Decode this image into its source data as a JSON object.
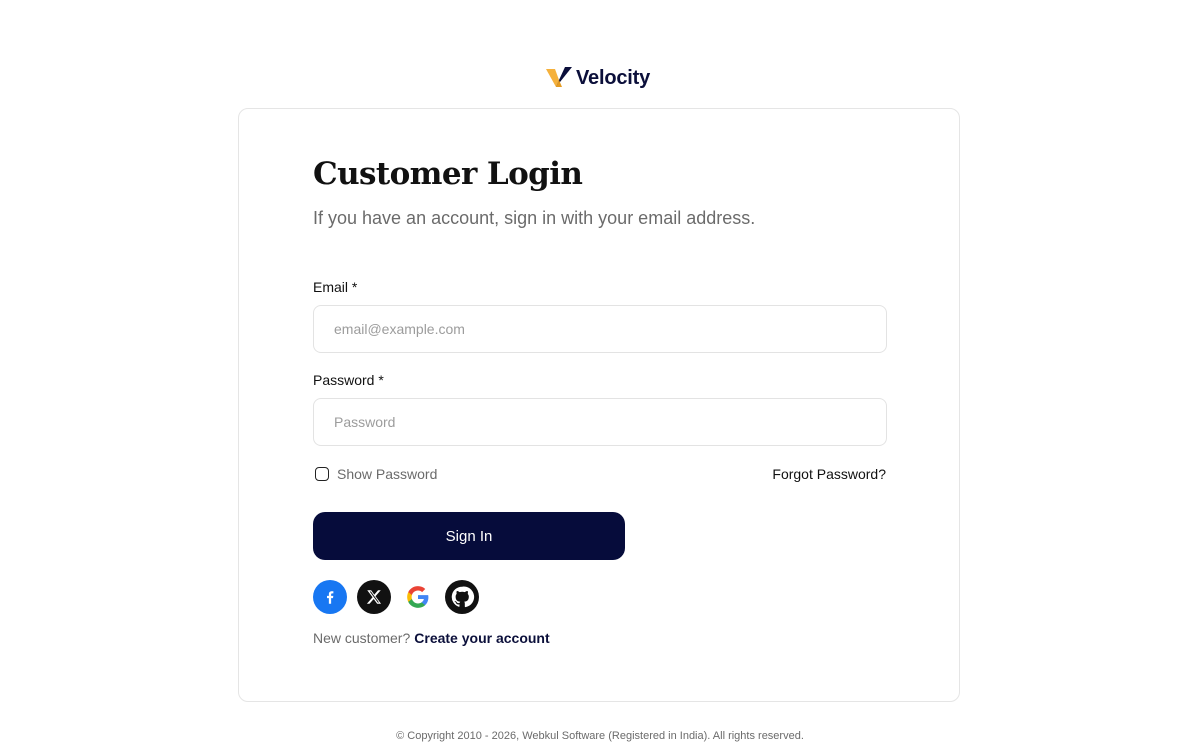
{
  "brand": {
    "name": "Velocity",
    "logo_icon": "velocity-v-logo",
    "colors": {
      "mark_gold": "#f5b13c",
      "mark_navy": "#0b0f3a"
    }
  },
  "login": {
    "title": "Customer Login",
    "subtitle": "If you have an account, sign in with your email address.",
    "email": {
      "label": "Email *",
      "placeholder": "email@example.com",
      "value": ""
    },
    "password": {
      "label": "Password *",
      "placeholder": "Password",
      "value": ""
    },
    "show_password": {
      "label": "Show Password",
      "checked": false
    },
    "forgot_password": "Forgot Password?",
    "submit": "Sign In",
    "socials": [
      {
        "name": "facebook",
        "icon": "facebook-icon",
        "color": "#1877f2"
      },
      {
        "name": "x",
        "icon": "x-icon",
        "color": "#111111"
      },
      {
        "name": "google",
        "icon": "google-icon",
        "color": "#ffffff"
      },
      {
        "name": "github",
        "icon": "github-icon",
        "color": "#111111"
      }
    ],
    "new_customer": {
      "text": "New customer?",
      "link": "Create your account"
    }
  },
  "footer": {
    "copyright": "© Copyright 2010 - 2026, Webkul Software (Registered in India). All rights reserved."
  },
  "theme": {
    "primary": "#060c3b",
    "border": "#e3e3e3",
    "muted_text": "#6b6b6b"
  }
}
